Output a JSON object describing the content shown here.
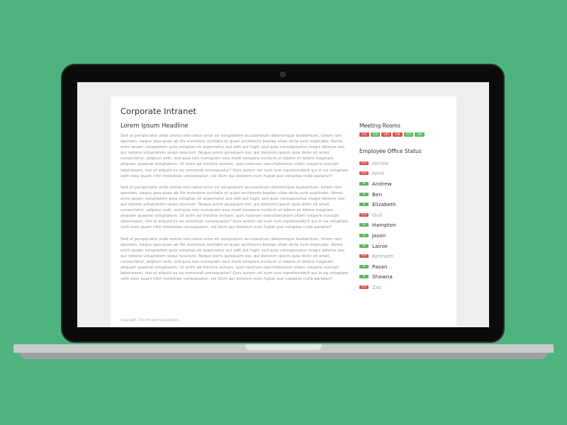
{
  "colors": {
    "background": "#4fb37f",
    "in": "#5cb85c",
    "out": "#d9534f"
  },
  "site": {
    "title": "Corporate Intranet",
    "headline": "Lorem Ipsum Headline",
    "paragraphs": [
      "Sed ut perspiciatis unde omnis iste natus error sit voluptatem accusantium doloremque laudantium, totam rem aperiam, eaque ipsa quae ab illo inventore veritatis et quasi architecto beatae vitae dicta sunt explicabo. Nemo enim ipsam voluptatem quia voluptas sit aspernatur aut odit aut fugit, sed quia consequuntur magni dolores eos qui ratione voluptatem sequi nesciunt. Neque porro quisquam est, qui dolorem ipsum quia dolor sit amet, consectetur, adipisci velit, sed quia non numquam eius modi tempora incidunt ut labore et dolore magnam aliquam quaerat voluptatem. Ut enim ad minima veniam, quis nostrum exercitationem ullam corporis suscipit laboriosam, nisi ut aliquid ex ea commodi consequatur? Quis autem vel eum iure reprehenderit qui in ea voluptate velit esse quam nihil molestiae consequatur, vel illum qui dolorem eum fugiat quo voluptas nulla pariatur?",
      "Sed ut perspiciatis unde omnis iste natus error sit voluptatem accusantium doloremque laudantium, totam rem aperiam, eaque ipsa quae ab illo inventore veritatis et quasi architecto beatae vitae dicta sunt explicabo. Nemo enim ipsam voluptatem quia voluptas sit aspernatur aut odit aut fugit, sed quia consequuntur magni dolores eos qui ratione voluptatem sequi nesciunt. Neque porro quisquam est, qui dolorem ipsum quia dolor sit amet, consectetur, adipisci velit, sed quia non numquam eius modi tempora incidunt ut labore et dolore magnam aliquam quaerat voluptatem. Ut enim ad minima veniam, quis nostrum exercitationem ullam corporis suscipit laboriosam, nisi ut aliquid ex ea commodi consequatur? Quis autem vel eum iure reprehenderit qui in ea voluptate velit esse quam nihil molestiae consequatur, vel illum qui dolorem eum fugiat quo voluptas nulla pariatur?",
      "Sed ut perspiciatis unde omnis iste natus error sit voluptatem accusantium doloremque laudantium, totam rem aperiam, eaque ipsa quae ab illo inventore veritatis et quasi architecto beatae vitae dicta sunt explicabo. Nemo enim ipsam voluptatem quia voluptas sit aspernatur aut odit aut fugit, sed quia consequuntur magni dolores eos qui ratione voluptatem sequi nesciunt. Neque porro quisquam est, qui dolorem ipsum quia dolor sit amet, consectetur, adipisci velit, sed quia non numquam eius modi tempora incidunt ut labore et dolore magnam aliquam quaerat voluptatem. Ut enim ad minima veniam, quis nostrum exercitationem ullam corporis suscipit laboriosam, nisi ut aliquid ex ea commodi consequatur? Quis autem vel eum iure reprehenderit qui in ea voluptate velit esse quam nihil molestiae consequatur, vel illum qui dolorem eum fugiat quo voluptas nulla pariatur?"
    ],
    "copyright": "Copyright, The Intranet Corporation"
  },
  "meeting_rooms": {
    "title": "Meeting Rooms",
    "rooms": [
      {
        "label": "101",
        "status": "out"
      },
      {
        "label": "102",
        "status": "in"
      },
      {
        "label": "103",
        "status": "out"
      },
      {
        "label": "104",
        "status": "out"
      },
      {
        "label": "105",
        "status": "in"
      },
      {
        "label": "106",
        "status": "in"
      }
    ]
  },
  "employee_status": {
    "title": "Employee Office Status",
    "badge_in": "IN",
    "badge_out": "OUT",
    "employees": [
      {
        "name": "Aimee",
        "status": "out"
      },
      {
        "name": "Amit",
        "status": "out"
      },
      {
        "name": "Andrew",
        "status": "in"
      },
      {
        "name": "Ben",
        "status": "in"
      },
      {
        "name": "Elizabeth",
        "status": "in"
      },
      {
        "name": "Guil",
        "status": "out"
      },
      {
        "name": "Hampton",
        "status": "in"
      },
      {
        "name": "Jason",
        "status": "in"
      },
      {
        "name": "Lainie",
        "status": "in"
      },
      {
        "name": "Kenneth",
        "status": "out"
      },
      {
        "name": "Pasan",
        "status": "in"
      },
      {
        "name": "Shawna",
        "status": "in"
      },
      {
        "name": "Zac",
        "status": "out"
      }
    ]
  }
}
